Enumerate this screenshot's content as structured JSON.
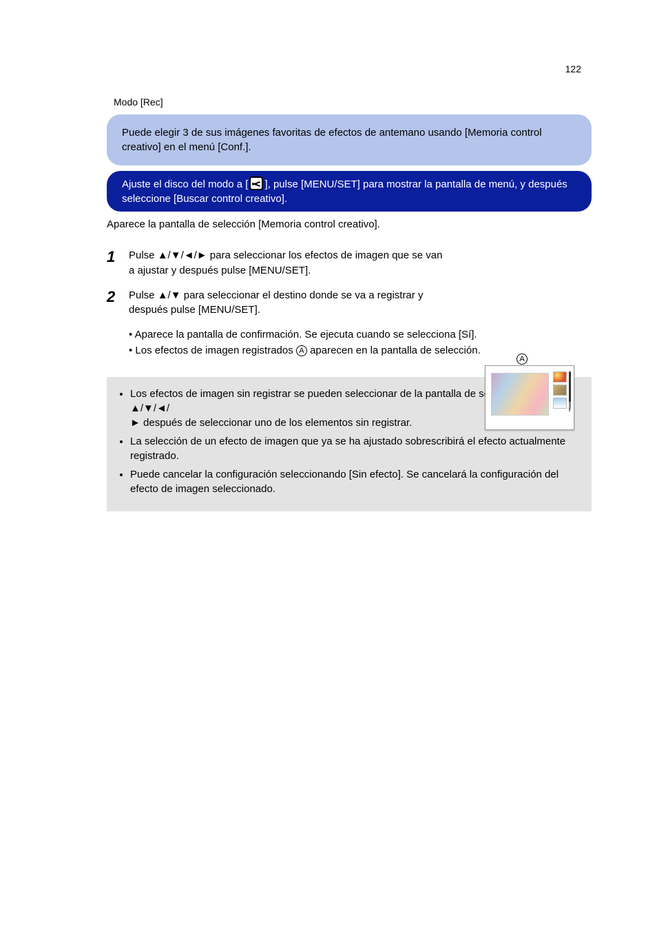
{
  "page_number": "122",
  "section_title": "Modo [Rec]",
  "light_box_text": "Puede elegir 3 de sus imágenes favoritas de efectos de antemano usando [Memoria control creativo] en el menú [Conf.].",
  "dark_box_p1": "Ajuste el disco del modo a [",
  "dark_box_p2": "], pulse [MENU/SET] para mostrar la pantalla de menú, y después seleccione [Buscar control creativo].",
  "after_box": "Aparece la pantalla de selección [Memoria control creativo].",
  "steps": {
    "s1_a": "Pulse ",
    "s1_arrows": "▲/▼/◄/►",
    "s1_b": " para seleccionar los efectos de imagen que se van a ajustar y después pulse [MENU/SET].",
    "s2_a": "Pulse ",
    "s2_arrows": "▲/▼",
    "s2_b": " para seleccionar el destino donde se va a registrar y después pulse [MENU/SET]."
  },
  "sub_lines": {
    "a": "Aparece la pantalla de confirmación. Se ejecuta cuando se selecciona [Sí].",
    "b_pre": "Los efectos de imagen registrados ",
    "b_post": " aparecen en la pantalla de selección."
  },
  "circled_label": "A",
  "note_items": {
    "n1_a": "Los efectos de imagen sin registrar se pueden seleccionar de la pantalla de selección pulsando ",
    "n1_arrows1": "▲/▼/◄/",
    "n1_arrows2": "►",
    "n1_b": " después de seleccionar uno de los elementos sin registrar.",
    "n2": "La selección de un efecto de imagen que ya se ha ajustado sobrescribirá el efecto actualmente registrado.",
    "n3": "Puede cancelar la configuración seleccionando [Sin efecto]. Se cancelará la configuración del efecto de imagen seleccionado."
  }
}
